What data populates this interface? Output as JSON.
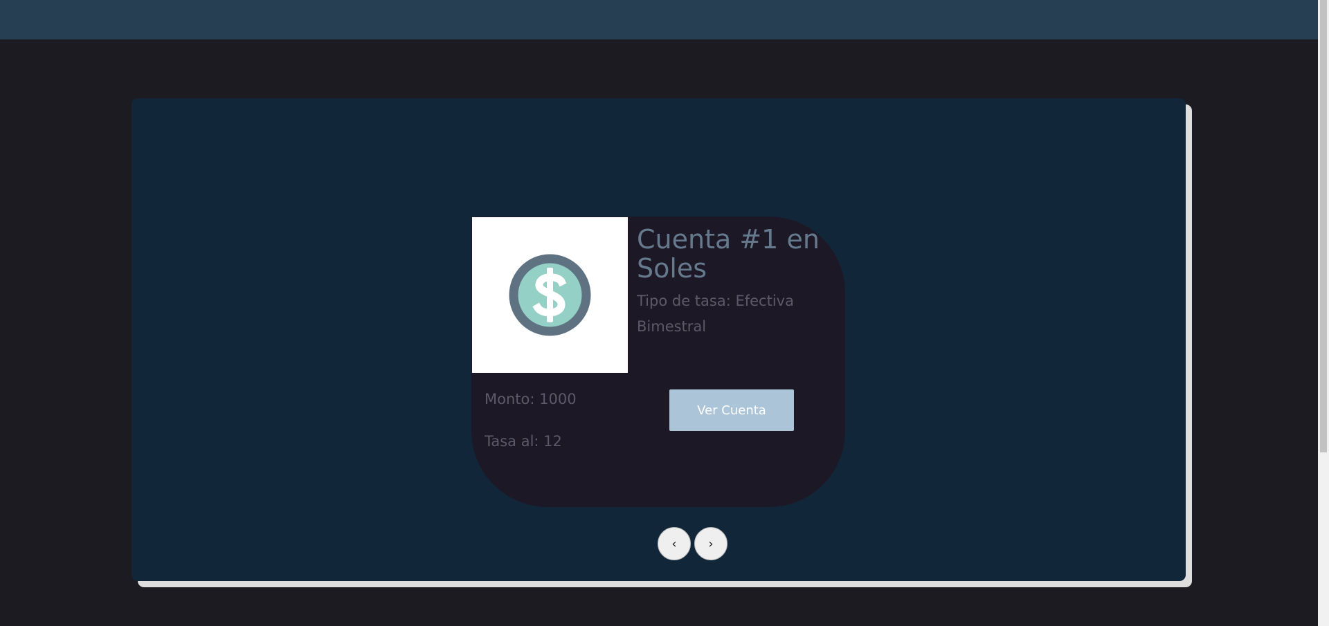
{
  "card": {
    "title": "Cuenta #1 en Soles",
    "rate_type": "Tipo de tasa: Efectiva Bimestral",
    "amount": "Monto: 1000",
    "rate": "Tasa al: 12",
    "button_label": "Ver Cuenta",
    "icon": "dollar-coin-icon"
  },
  "carousel": {
    "prev_label": "‹",
    "next_label": "›"
  },
  "colors": {
    "topbar": "#263f53",
    "background": "#1c1b21",
    "panel": "#12263a",
    "card": "#1c1826",
    "button": "#acc4d8",
    "coin_outer": "#5f7282",
    "coin_inner": "#94d0c5"
  }
}
